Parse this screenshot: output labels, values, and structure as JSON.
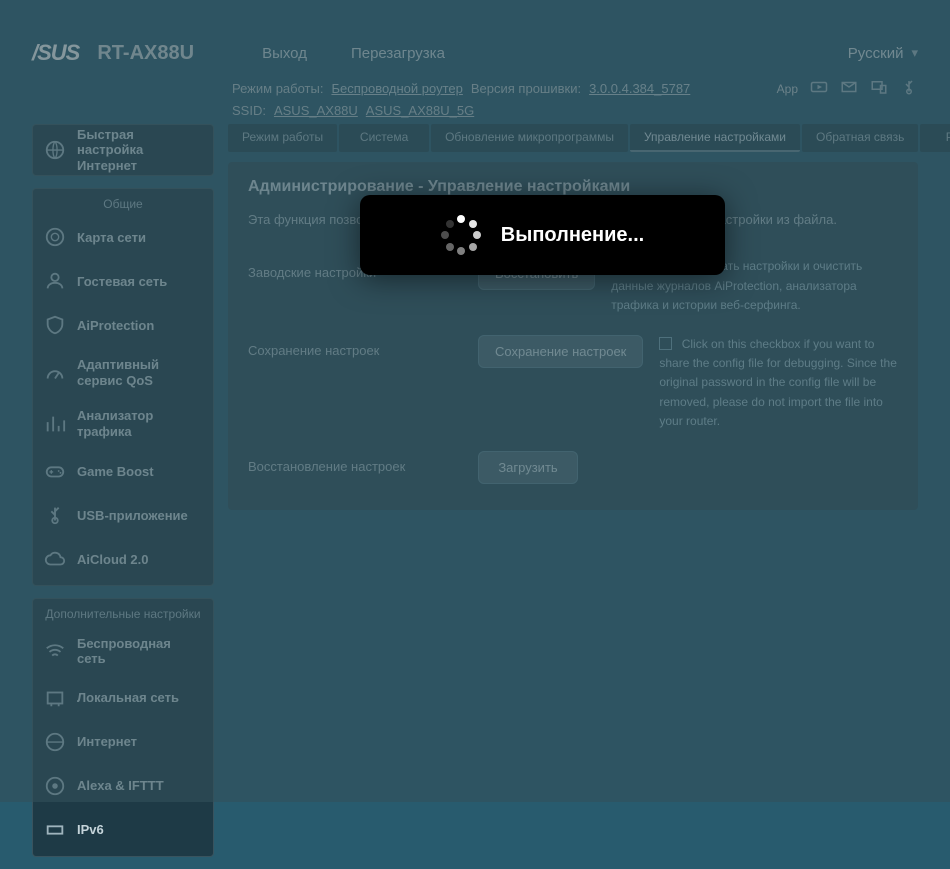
{
  "brand": "/SUS",
  "model": "RT-AX88U",
  "topTabs": {
    "logout": "Выход",
    "reboot": "Перезагрузка"
  },
  "lang": "Русский",
  "info1": {
    "modeLabel": "Режим работы:",
    "modeLink": "Беспроводной роутер",
    "fwLabel": "Версия прошивки:",
    "fwLink": "3.0.0.4.384_5787",
    "appLabel": "App"
  },
  "info2": {
    "ssidLabel": "SSID:",
    "ssid1": "ASUS_AX88U",
    "ssid2": "ASUS_AX88U_5G"
  },
  "sidebar": {
    "quick": {
      "label": "Быстрая настройка Интернет"
    },
    "generalTitle": "Общие",
    "general": [
      {
        "name": "network-map",
        "label": "Карта сети"
      },
      {
        "name": "guest-network",
        "label": "Гостевая сеть"
      },
      {
        "name": "aiprotection",
        "label": "AiProtection"
      },
      {
        "name": "adaptive-qos",
        "label": "Адаптивный сервис QoS"
      },
      {
        "name": "traffic-analyzer",
        "label": "Анализатор трафика"
      },
      {
        "name": "game-boost",
        "label": "Game Boost"
      },
      {
        "name": "usb-app",
        "label": "USB-приложение"
      },
      {
        "name": "aicloud",
        "label": "AiCloud 2.0"
      }
    ],
    "advancedTitle": "Дополнительные настройки",
    "advanced": [
      {
        "name": "wireless",
        "label": "Беспроводная сеть"
      },
      {
        "name": "lan",
        "label": "Локальная сеть"
      },
      {
        "name": "internet",
        "label": "Интернет"
      },
      {
        "name": "alexa-ifttt",
        "label": "Alexa & IFTTT"
      },
      {
        "name": "ipv6",
        "label": "IPv6"
      }
    ]
  },
  "subtabs": [
    {
      "name": "op-mode",
      "label": "Режим работы"
    },
    {
      "name": "system",
      "label": "Система"
    },
    {
      "name": "firmware",
      "label": "Обновление микропрограммы"
    },
    {
      "name": "settings-mgmt",
      "label": "Управление настройками"
    },
    {
      "name": "feedback",
      "label": "Обратная связь"
    },
    {
      "name": "privacy",
      "label": "Privacy"
    }
  ],
  "panel": {
    "title": "Администрирование - Управление настройками",
    "desc": "Эта функция позволяет сохранять настройки RT-AX88U в файл и загружать настройки из файла.",
    "rows": {
      "restore": {
        "label": "Заводские настройки",
        "btn": "Восстановить",
        "side": "Инициализировать настройки и очистить данные журналов AiProtection, анализатора трафика и истории веб-серфинга."
      },
      "save": {
        "label": "Сохранение настроек",
        "btn": "Сохранение настроек",
        "side": "Click on this checkbox if you want to share the config file for debugging. Since the original password in the config file will be removed, please do not import the file into your router."
      },
      "upload": {
        "label": "Восстановление настроек",
        "btn": "Загрузить"
      }
    }
  },
  "modal": {
    "text": "Выполнение..."
  }
}
